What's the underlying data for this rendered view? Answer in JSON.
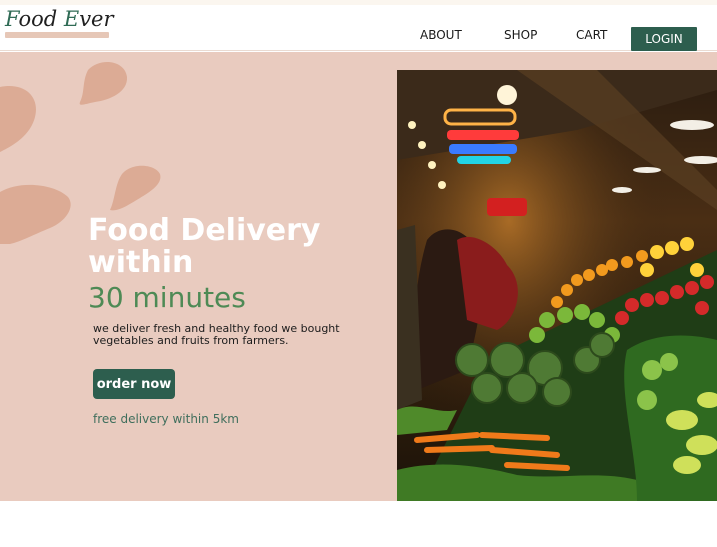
{
  "header": {
    "logo_part1": "F",
    "logo_part2": "ood ",
    "logo_part3": "E",
    "logo_part4": "ver",
    "nav": [
      {
        "label": "ABOUT"
      },
      {
        "label": "SHOP"
      },
      {
        "label": "CART"
      }
    ],
    "login_label": "LOGIN"
  },
  "hero": {
    "title": "Food Delivery within",
    "subtitle": "30 minutes",
    "description": "we deliver fresh and healthy food we bought vegetables and fruits from farmers.",
    "cta_label": "order now",
    "note": "free  delivery within 5km",
    "image_icon": "market-produce-photo"
  },
  "colors": {
    "brand_green": "#2d5e4e",
    "hero_bg": "#e9cbbf",
    "accent_green": "#4e8a55",
    "blob": "#dcab95"
  }
}
